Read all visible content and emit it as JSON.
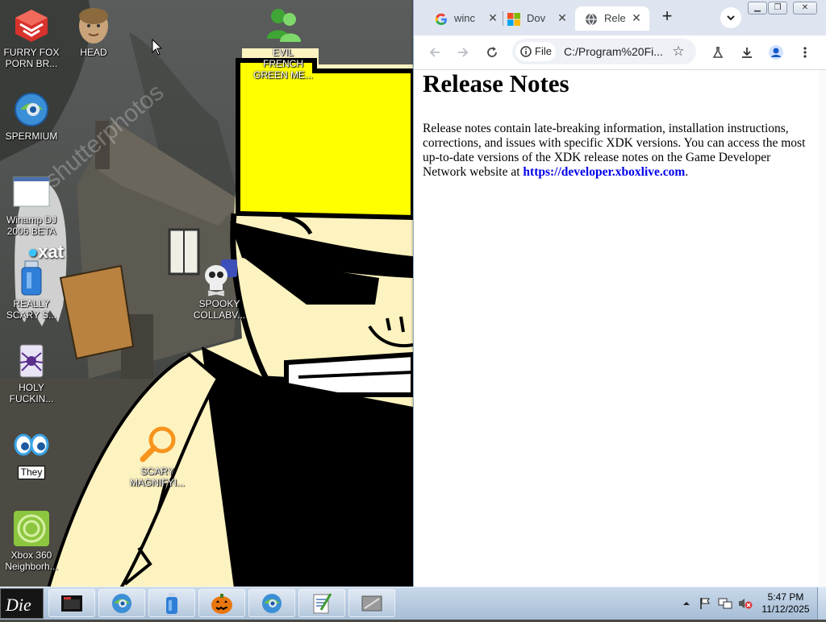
{
  "desktop": {
    "icons": [
      {
        "label": "FURRY FOX PORN BR...",
        "icon": "red-cube-browser-icon"
      },
      {
        "label": "HEAD",
        "icon": "head-avatar-icon"
      },
      {
        "label": "EVIL FRENCH GREEN ME...",
        "icon": "green-messenger-people-icon"
      },
      {
        "label": "SPERMIUM",
        "icon": "blue-globe-browser-icon"
      },
      {
        "label": "Winamp DJ 2006 BETA",
        "icon": "blank-window-icon"
      },
      {
        "label": "REALLY SCARY S...",
        "icon": "blue-usb-drive-icon"
      },
      {
        "label": "SPOOKY COLLABV...",
        "icon": "skull-icon"
      },
      {
        "label": "HOLY FUCKIN...",
        "icon": "spider-card-icon"
      },
      {
        "label": "They",
        "icon": "eyes-icon",
        "editing": true
      },
      {
        "label": "SCARY MAGNIFYI...",
        "icon": "magnifier-icon"
      },
      {
        "label": "Xbox 360 Neighborh...",
        "icon": "green-xbox-icon"
      }
    ],
    "wallpaper_logo": "xat"
  },
  "browser": {
    "tabs": [
      {
        "title": "winc",
        "favicon": "google-g-icon",
        "active": false
      },
      {
        "title": "Dov",
        "favicon": "microsoft-logo-icon",
        "active": false
      },
      {
        "title": "Rele",
        "favicon": "globe-icon",
        "active": true
      }
    ],
    "address": {
      "scheme_chip": "File",
      "url": "C:/Program%20Fi..."
    },
    "page": {
      "heading": "Release Notes",
      "body": "Release notes contain late-breaking information, installation instructions, corrections, and issues with specific XDK versions. You can access the most up-to-date versions of the XDK release notes on the Game Developer Network website at ",
      "link": "https://developer.xboxlive.com",
      "after_link": "."
    },
    "colors": {
      "tabstrip": "#dfe5f0",
      "link": "#0000ee"
    }
  },
  "taskbar": {
    "start_label": "Die",
    "clock": {
      "time": "5:47 PM",
      "date": "11/12/2025"
    }
  }
}
